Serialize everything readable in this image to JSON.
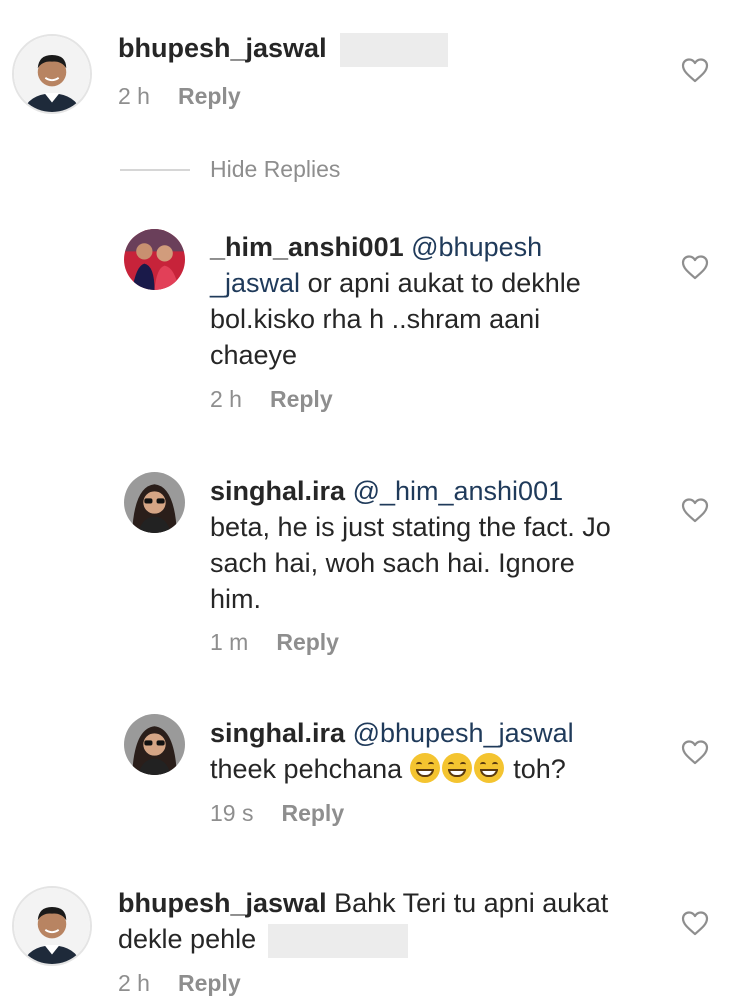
{
  "comment1": {
    "username": "bhupesh_jaswal",
    "time": "2 h",
    "reply_label": "Reply"
  },
  "hide_replies_label": "Hide Replies",
  "reply1": {
    "username": "_him_anshi001",
    "mention": "@bhupesh _jaswal",
    "text": "or apni aukat to dekhle bol.kisko rha h ..shram aani chaeye",
    "time": "2 h",
    "reply_label": "Reply"
  },
  "reply2": {
    "username": "singhal.ira",
    "mention": "@_him_anshi001",
    "text": "beta, he is just stating the fact. Jo sach hai, woh sach hai. Ignore him.",
    "time": "1 m",
    "reply_label": "Reply"
  },
  "reply3": {
    "username": "singhal.ira",
    "mention": "@bhupesh_jaswal",
    "text_before": "theek pehchana",
    "text_after": "toh?",
    "emoji": "laughing-emoji",
    "time": "19 s",
    "reply_label": "Reply"
  },
  "comment2": {
    "username": "bhupesh_jaswal",
    "text": "Bahk Teri tu apni aukat dekle pehle",
    "time": "2 h",
    "reply_label": "Reply"
  },
  "icons": {
    "like": "heart-outline-icon"
  },
  "colors": {
    "mention": "#1f3a5a",
    "meta": "#8e8e8e",
    "text": "#262626"
  }
}
